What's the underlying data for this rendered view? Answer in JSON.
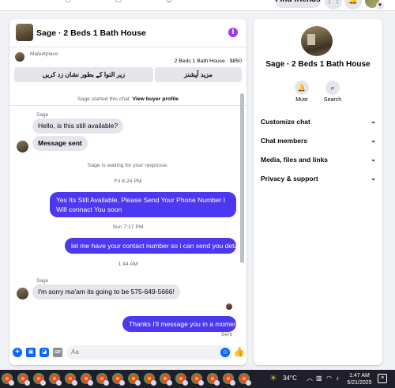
{
  "topnav": {
    "find_friends": "Find friends"
  },
  "chat": {
    "title": "Sage · 2 Beds 1 Bath House",
    "listing": {
      "marketplace_label": "Marketplace",
      "item_title": "2 Beds 1 Bath House · $850",
      "button_primary": "زیر التوا کے بطور نشان زد کریں",
      "button_secondary": "مزید آپشنز"
    },
    "messages": {
      "started": "Sage started this chat.",
      "view_profile": "View buyer profile",
      "sender_1": "Sage",
      "msg_1": "Hello, is this still available?",
      "msg_2": "Message sent",
      "waiting": "Sage is waiting for your response.",
      "time_1": "Fri 6:24 PM",
      "out_1": "Yes Its Still Available, Please Send Your Phone Number I Will connact You soon",
      "time_2": "Sun 7:17 PM",
      "out_2": "let me have your contact number so i can send you detail",
      "time_3": "1:44 AM",
      "sender_2": "Sage",
      "msg_3": "I'm sorry ma'am its going to be 575-649-5666!",
      "out_3": "Thanks I'll message you in a moment",
      "sent_status": "Sent"
    },
    "composer": {
      "placeholder": "Aa"
    }
  },
  "info": {
    "name": "Sage · 2 Beds 1 Bath House",
    "mute_label": "Mute",
    "search_label": "Search",
    "sections": [
      "Customize chat",
      "Chat members",
      "Media, files and links",
      "Privacy & support"
    ]
  },
  "taskbar": {
    "temperature": "34°C",
    "time": "1:47 AM",
    "date": "5/21/2025"
  },
  "colors": {
    "accent": "#4b38f0",
    "messenger_blue": "#0866ff",
    "info_purple": "#a033ff"
  }
}
